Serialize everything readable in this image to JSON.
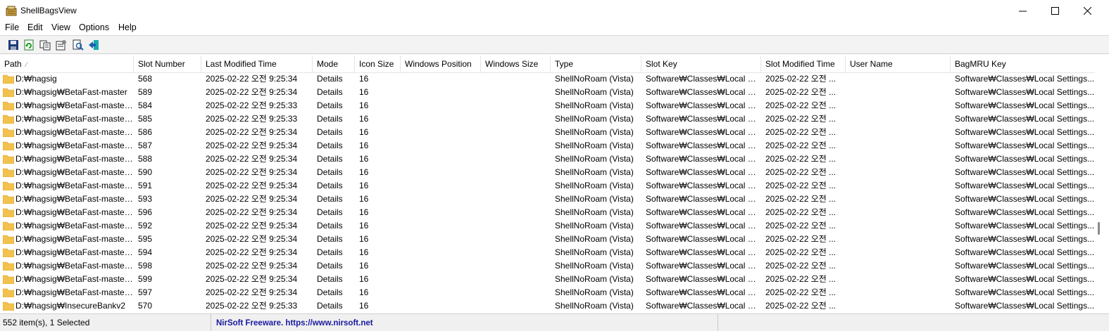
{
  "window": {
    "title": "ShellBagsView"
  },
  "menu": [
    "File",
    "Edit",
    "View",
    "Options",
    "Help"
  ],
  "toolbar": [
    "save-icon",
    "refresh-icon",
    "copy-icon",
    "properties-icon",
    "find-icon",
    "exit-icon"
  ],
  "columns": [
    "Path",
    "Slot Number",
    "Last Modified Time",
    "Mode",
    "Icon Size",
    "Windows Position",
    "Windows Size",
    "Type",
    "Slot Key",
    "Slot Modified Time",
    "User Name",
    "BagMRU Key"
  ],
  "rows": [
    [
      "D:₩hagsig",
      "568",
      "2025-02-22 오전 9:25:34",
      "Details",
      "16",
      "",
      "",
      "ShellNoRoam (Vista)",
      "Software₩Classes₩Local Se...",
      "2025-02-22 오전 ...",
      "",
      "Software₩Classes₩Local Settings..."
    ],
    [
      "D:₩hagsig₩BetaFast-master",
      "589",
      "2025-02-22 오전 9:25:34",
      "Details",
      "16",
      "",
      "",
      "ShellNoRoam (Vista)",
      "Software₩Classes₩Local Se...",
      "2025-02-22 오전 ...",
      "",
      "Software₩Classes₩Local Settings..."
    ],
    [
      "D:₩hagsig₩BetaFast-master ...",
      "584",
      "2025-02-22 오전 9:25:33",
      "Details",
      "16",
      "",
      "",
      "ShellNoRoam (Vista)",
      "Software₩Classes₩Local Se...",
      "2025-02-22 오전 ...",
      "",
      "Software₩Classes₩Local Settings..."
    ],
    [
      "D:₩hagsig₩BetaFast-master ...",
      "585",
      "2025-02-22 오전 9:25:33",
      "Details",
      "16",
      "",
      "",
      "ShellNoRoam (Vista)",
      "Software₩Classes₩Local Se...",
      "2025-02-22 오전 ...",
      "",
      "Software₩Classes₩Local Settings..."
    ],
    [
      "D:₩hagsig₩BetaFast-master ...",
      "586",
      "2025-02-22 오전 9:25:34",
      "Details",
      "16",
      "",
      "",
      "ShellNoRoam (Vista)",
      "Software₩Classes₩Local Se...",
      "2025-02-22 오전 ...",
      "",
      "Software₩Classes₩Local Settings..."
    ],
    [
      "D:₩hagsig₩BetaFast-master ...",
      "587",
      "2025-02-22 오전 9:25:34",
      "Details",
      "16",
      "",
      "",
      "ShellNoRoam (Vista)",
      "Software₩Classes₩Local Se...",
      "2025-02-22 오전 ...",
      "",
      "Software₩Classes₩Local Settings..."
    ],
    [
      "D:₩hagsig₩BetaFast-master ...",
      "588",
      "2025-02-22 오전 9:25:34",
      "Details",
      "16",
      "",
      "",
      "ShellNoRoam (Vista)",
      "Software₩Classes₩Local Se...",
      "2025-02-22 오전 ...",
      "",
      "Software₩Classes₩Local Settings..."
    ],
    [
      "D:₩hagsig₩BetaFast-master...",
      "590",
      "2025-02-22 오전 9:25:34",
      "Details",
      "16",
      "",
      "",
      "ShellNoRoam (Vista)",
      "Software₩Classes₩Local Se...",
      "2025-02-22 오전 ...",
      "",
      "Software₩Classes₩Local Settings..."
    ],
    [
      "D:₩hagsig₩BetaFast-master...",
      "591",
      "2025-02-22 오전 9:25:34",
      "Details",
      "16",
      "",
      "",
      "ShellNoRoam (Vista)",
      "Software₩Classes₩Local Se...",
      "2025-02-22 오전 ...",
      "",
      "Software₩Classes₩Local Settings..."
    ],
    [
      "D:₩hagsig₩BetaFast-master...",
      "593",
      "2025-02-22 오전 9:25:34",
      "Details",
      "16",
      "",
      "",
      "ShellNoRoam (Vista)",
      "Software₩Classes₩Local Se...",
      "2025-02-22 오전 ...",
      "",
      "Software₩Classes₩Local Settings..."
    ],
    [
      "D:₩hagsig₩BetaFast-master...",
      "596",
      "2025-02-22 오전 9:25:34",
      "Details",
      "16",
      "",
      "",
      "ShellNoRoam (Vista)",
      "Software₩Classes₩Local Se...",
      "2025-02-22 오전 ...",
      "",
      "Software₩Classes₩Local Settings..."
    ],
    [
      "D:₩hagsig₩BetaFast-master...",
      "592",
      "2025-02-22 오전 9:25:34",
      "Details",
      "16",
      "",
      "",
      "ShellNoRoam (Vista)",
      "Software₩Classes₩Local Se...",
      "2025-02-22 오전 ...",
      "",
      "Software₩Classes₩Local Settings..."
    ],
    [
      "D:₩hagsig₩BetaFast-master...",
      "595",
      "2025-02-22 오전 9:25:34",
      "Details",
      "16",
      "",
      "",
      "ShellNoRoam (Vista)",
      "Software₩Classes₩Local Se...",
      "2025-02-22 오전 ...",
      "",
      "Software₩Classes₩Local Settings..."
    ],
    [
      "D:₩hagsig₩BetaFast-master...",
      "594",
      "2025-02-22 오전 9:25:34",
      "Details",
      "16",
      "",
      "",
      "ShellNoRoam (Vista)",
      "Software₩Classes₩Local Se...",
      "2025-02-22 오전 ...",
      "",
      "Software₩Classes₩Local Settings..."
    ],
    [
      "D:₩hagsig₩BetaFast-master...",
      "598",
      "2025-02-22 오전 9:25:34",
      "Details",
      "16",
      "",
      "",
      "ShellNoRoam (Vista)",
      "Software₩Classes₩Local Se...",
      "2025-02-22 오전 ...",
      "",
      "Software₩Classes₩Local Settings..."
    ],
    [
      "D:₩hagsig₩BetaFast-master...",
      "599",
      "2025-02-22 오전 9:25:34",
      "Details",
      "16",
      "",
      "",
      "ShellNoRoam (Vista)",
      "Software₩Classes₩Local Se...",
      "2025-02-22 오전 ...",
      "",
      "Software₩Classes₩Local Settings..."
    ],
    [
      "D:₩hagsig₩BetaFast-master...",
      "597",
      "2025-02-22 오전 9:25:34",
      "Details",
      "16",
      "",
      "",
      "ShellNoRoam (Vista)",
      "Software₩Classes₩Local Se...",
      "2025-02-22 오전 ...",
      "",
      "Software₩Classes₩Local Settings..."
    ],
    [
      "D:₩hagsig₩InsecureBankv2",
      "570",
      "2025-02-22 오전 9:25:33",
      "Details",
      "16",
      "",
      "",
      "ShellNoRoam (Vista)",
      "Software₩Classes₩Local Se...",
      "2025-02-22 오전 ...",
      "",
      "Software₩Classes₩Local Settings..."
    ]
  ],
  "status": {
    "items": "552 item(s), 1 Selected",
    "link": "NirSoft Freeware. https://www.nirsoft.net"
  },
  "colors": {
    "folder": "#f2c14e",
    "link": "#1a1aa0"
  }
}
